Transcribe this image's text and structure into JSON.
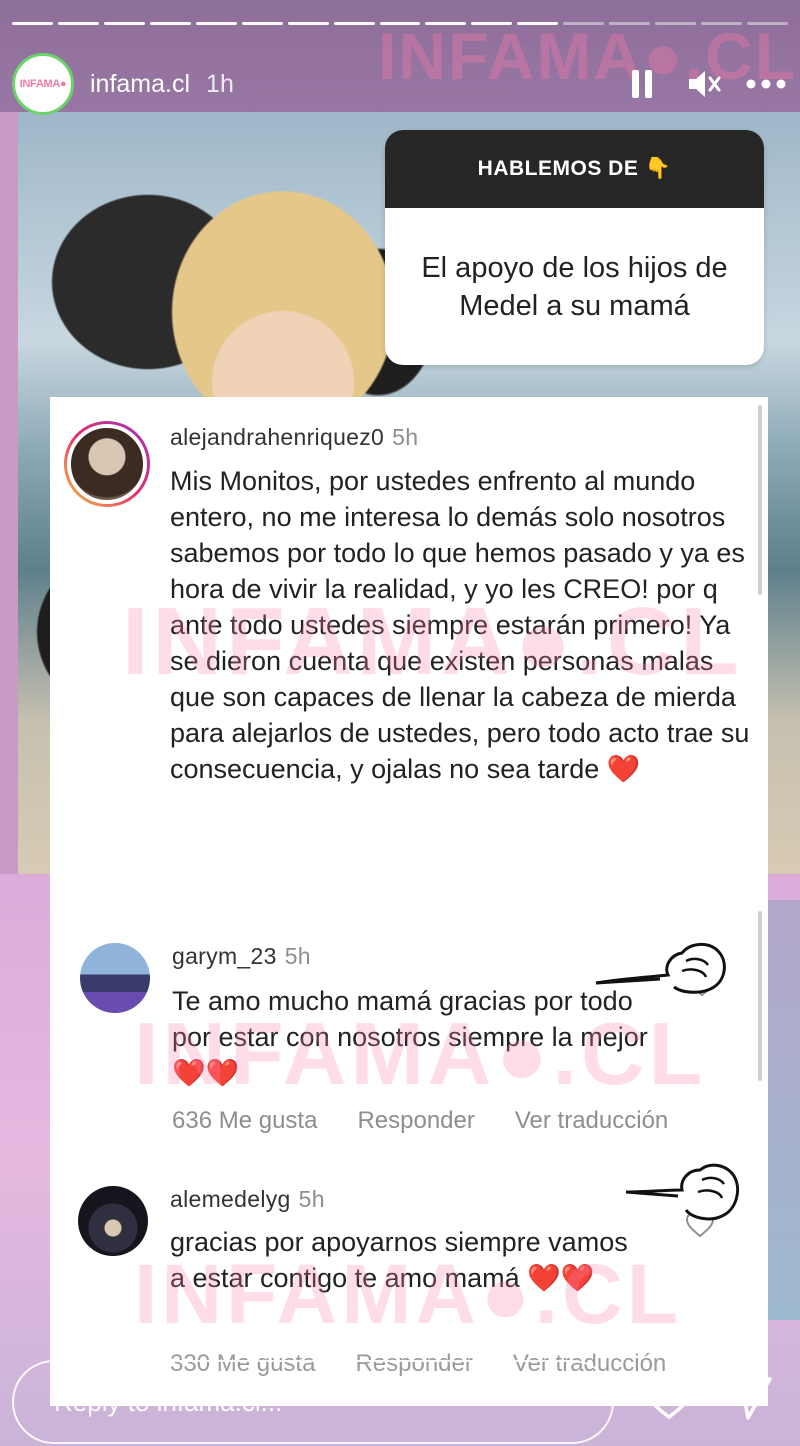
{
  "story": {
    "username": "infama.cl",
    "time_ago": "1h",
    "avatar_text": "INFAMA●",
    "watermark": "INFAMA●.CL",
    "progress_segments": 17,
    "progress_active": 12
  },
  "header_icons": [
    "pause-icon",
    "mute-icon",
    "more-icon"
  ],
  "question": {
    "header": "HABLEMOS DE 👇",
    "body": "El apoyo de los hijos de Medel a su mamá"
  },
  "comments": [
    {
      "username": "alejandrahenriquez0",
      "time_ago": "5h",
      "text": "Mis Monitos, por ustedes enfrento al mundo entero, no me interesa lo demás solo nosotros sabemos por todo lo que hemos pasado y ya es hora  de vivir la realidad,  y yo les CREO! por q ante todo ustedes siempre estarán primero! Ya se dieron cuenta que existen personas malas que son capaces de llenar la cabeza de mierda para alejarlos de ustedes, pero todo acto trae su consecuencia, y ojalas no sea tarde",
      "emoji": "❤️"
    },
    {
      "username": "garym_23",
      "time_ago": "5h",
      "text": "Te amo mucho mamá gracias por todo por estar con nosotros siempre la mejor",
      "emoji": "❤️❤️",
      "likes": "636 Me gusta",
      "reply": "Responder",
      "translate": "Ver traducción"
    },
    {
      "username": "alemedelyg",
      "time_ago": "5h",
      "text": "gracias por apoyarnos siempre vamos a estar contigo te amo mamá",
      "emoji": "❤️❤️",
      "likes": "330 Me gusta",
      "reply": "Responder",
      "translate": "Ver traducción"
    }
  ],
  "reply_bar": {
    "placeholder": "Reply to infama.cl..."
  },
  "footer_icons": [
    "heart-icon",
    "send-icon"
  ]
}
